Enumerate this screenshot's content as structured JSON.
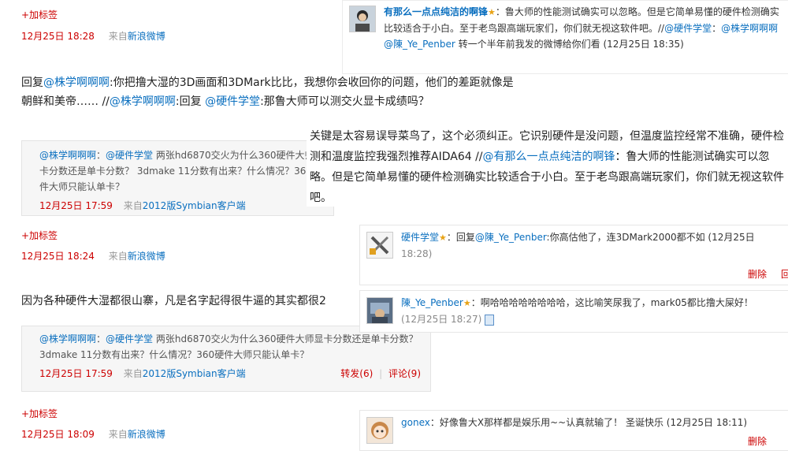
{
  "posts": [
    {
      "add_tag": "+加标签",
      "time": "12月25日 18:28",
      "src_prefix": "来自",
      "src_app": "新浪微博"
    },
    {
      "text_prefix": "回复",
      "mention1": "@株学啊啊啊",
      "text1": ":你把撸大湿的3D画面和3DMark比比，我想你会收回你的问题，他们的差距就像是朝鲜和美帝…… //",
      "mention2": "@株学啊啊啊",
      "text2": ":回复 ",
      "mention3": "@硬件学堂",
      "text3": ":那鲁大师可以测交火显卡成绩吗？",
      "quote": {
        "author": "@株学啊啊啊",
        "sep": "：",
        "mention": "@硬件学堂",
        "text": " 两张hd6870交火为什么360硬件大师显卡分数还是单卡分数？ 3dmake 11分数有出来？什么情况？360硬件大师只能认单卡？",
        "time": "12月25日 17:59",
        "src_prefix": "来自",
        "src_app": "2012版Symbian客户端"
      },
      "add_tag": "+加标签",
      "time": "12月25日 18:24",
      "src_prefix": "来自",
      "src_app": "新浪微博"
    },
    {
      "text": "因为各种硬件大湿都很山寨，凡是名字起得很牛逼的其实都很2",
      "quote": {
        "author": "@株学啊啊啊",
        "sep": "：",
        "mention": "@硬件学堂",
        "text": " 两张hd6870交火为什么360硬件大师显卡分数还是单卡分数？ 3dmake 11分数有出来？什么情况？360硬件大师只能认单卡？",
        "time": "12月25日 17:59",
        "src_prefix": "来自",
        "src_app": "2012版Symbian客户端",
        "repost": "转发(6)",
        "comment": "评论(9)"
      },
      "add_tag": "+加标签",
      "time": "12月25日 18:09",
      "src_prefix": "来自",
      "src_app": "新浪微博"
    }
  ],
  "overlay_top": {
    "user": "有那么一点点纯洁的啊锋",
    "text": "：鲁大师的性能测试确实可以忽略。但是它简单易懂的硬件检测确实比较适合于小白。至于老鸟跟高端玩家们，你们就无视这软件吧。//",
    "mention1": "@硬件学堂",
    "text2": "：",
    "mention2": "@株学啊啊啊",
    "mention3": "@陳_Ye_Penber",
    "text3": " 转一个半年前我发的微博给你们看 (12月25日 18:35)"
  },
  "overlay_big": {
    "text1": "关键是太容易误导菜鸟了，这个必须纠正。它识别硬件是没问题，但温度监控经常不准确，硬件检测和温度监控我强烈推荐AIDA64 //",
    "mention": "@有那么一点点纯洁的啊锋",
    "text2": "：鲁大师的性能测试确实可以忽略。但是它简单易懂的硬件检测确实比较适合于小白。至于老鸟跟高端玩家们，你们就无视这软件吧。"
  },
  "comments": [
    {
      "user": "硬件学堂",
      "text_prefix": "：回复",
      "mention": "@陳_Ye_Penber",
      "text": ":你高估他了，连3DMark2000都不如 (12月25日",
      "time": "18:28)",
      "delete": "删除",
      "delete2": "回"
    },
    {
      "user": "陳_Ye_Penber",
      "text": "：啊哈哈哈哈哈哈哈哈，这比喻笑尿我了，mark05都比撸大屎好！",
      "time": "(12月25日 18:27)"
    },
    {
      "user": "gonex",
      "text": "：好像鲁大X那样都是娱乐用~~认真就输了！ 圣诞快乐 (12月25日 18:11)",
      "delete": "删除"
    }
  ],
  "colors": {
    "link": "#0a6fbf",
    "time": "#cc0000",
    "quote_bg": "#f6f6f6"
  }
}
